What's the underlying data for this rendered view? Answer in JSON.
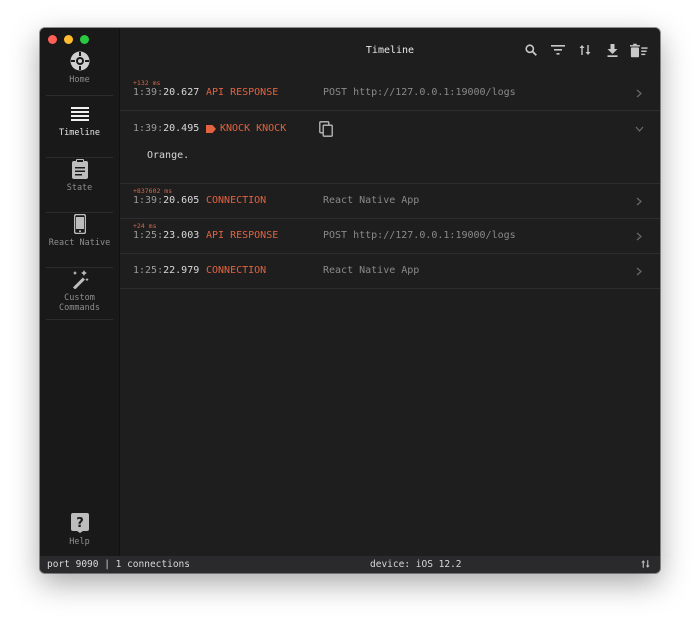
{
  "window": {
    "title": "Timeline"
  },
  "sidebar": {
    "items": [
      {
        "label": "Home",
        "icon": "home-icon"
      },
      {
        "label": "Timeline",
        "icon": "list-icon",
        "active": true
      },
      {
        "label": "State",
        "icon": "clipboard-icon"
      },
      {
        "label": "React Native",
        "icon": "phone-icon"
      },
      {
        "label_line1": "Custom",
        "label_line2": "Commands",
        "icon": "magic-wand-icon"
      }
    ],
    "help": {
      "label": "Help",
      "icon": "help-icon"
    }
  },
  "toolbar": {
    "icons": [
      "search-icon",
      "filter-icon",
      "reverse-order-icon",
      "download-icon",
      "clear-icon"
    ]
  },
  "timeline": {
    "rows": [
      {
        "delta": "+132 ms",
        "time_prefix": "1:39:",
        "time_main": "20.627",
        "type": "API RESPONSE",
        "summary": "POST http://127.0.0.1:19000/logs"
      },
      {
        "delta": "",
        "time_prefix": "1:39:",
        "time_main": "20.495",
        "type": "KNOCK KNOCK",
        "summary": "",
        "body": "Orange."
      },
      {
        "delta": "+837602 ms",
        "time_prefix": "1:39:",
        "time_main": "20.605",
        "type": "CONNECTION",
        "summary": "React Native App"
      },
      {
        "delta": "+24 ms",
        "time_prefix": "1:25:",
        "time_main": "23.003",
        "type": "API RESPONSE",
        "summary": "POST http://127.0.0.1:19000/logs"
      },
      {
        "delta": "",
        "time_prefix": "1:25:",
        "time_main": "22.979",
        "type": "CONNECTION",
        "summary": "React Native App"
      }
    ]
  },
  "status": {
    "left": "port 9090 | 1 connections",
    "center": "device: iOS 12.2"
  },
  "colors": {
    "accent": "#e1633f",
    "background": "#1e1e1f",
    "sidebar": "#19191a"
  }
}
